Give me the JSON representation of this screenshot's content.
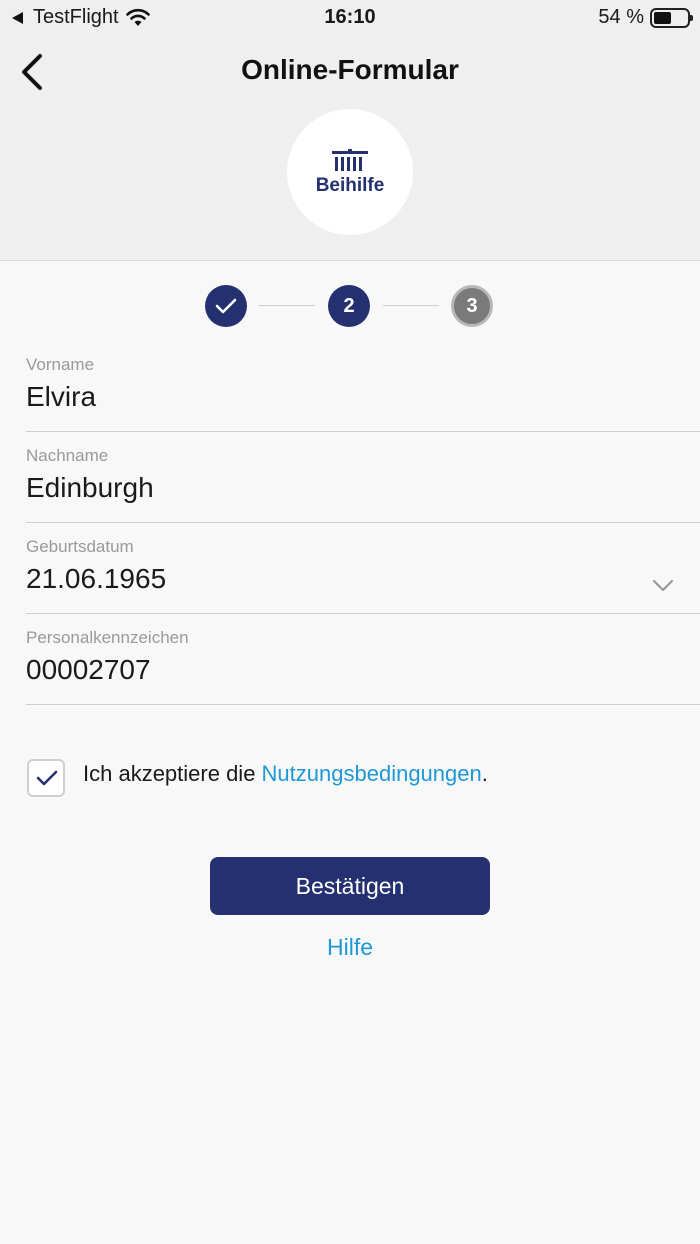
{
  "status_bar": {
    "back_app": "TestFlight",
    "time": "16:10",
    "battery_percent": "54 %",
    "battery_level": 0.54
  },
  "nav": {
    "title": "Online-Formular",
    "back_icon": "chevron-left-icon"
  },
  "logo": {
    "text": "Beihilfe",
    "icon": "building-columns-icon"
  },
  "stepper": {
    "steps": [
      {
        "label": "",
        "state": "done",
        "icon": "check-icon"
      },
      {
        "label": "2",
        "state": "active"
      },
      {
        "label": "3",
        "state": "todo"
      }
    ]
  },
  "form": {
    "fields": [
      {
        "label": "Vorname",
        "value": "Elvira"
      },
      {
        "label": "Nachname",
        "value": "Edinburgh"
      },
      {
        "label": "Geburtsdatum",
        "value": "21.06.1965",
        "icon": "chevron-down-icon"
      },
      {
        "label": "Personalkennzeichen",
        "value": "00002707"
      }
    ]
  },
  "terms": {
    "checked": true,
    "prefix": "Ich akzeptiere die ",
    "link": "Nutzungsbedingungen",
    "suffix": "."
  },
  "actions": {
    "confirm": "Bestätigen",
    "help": "Hilfe"
  },
  "colors": {
    "primary": "#243070",
    "link": "#1e98d7",
    "inactive_step": "#7a7a7a",
    "header_bg": "#efefef",
    "page_bg": "#f8f8f8"
  }
}
